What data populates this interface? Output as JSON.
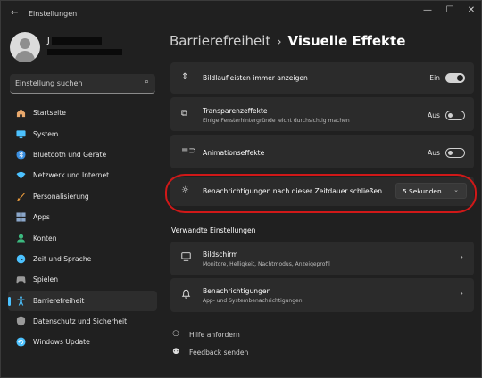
{
  "window": {
    "title": "Einstellungen"
  },
  "user": {
    "name_initial": "J"
  },
  "search": {
    "placeholder": "Einstellung suchen"
  },
  "sidebar": {
    "items": [
      {
        "label": "Startseite",
        "icon": "home-icon",
        "color": "#e8a86c"
      },
      {
        "label": "System",
        "icon": "monitor-icon",
        "color": "#4cc2ff"
      },
      {
        "label": "Bluetooth und Geräte",
        "icon": "bluetooth-icon",
        "color": "#3b8fe0"
      },
      {
        "label": "Netzwerk und Internet",
        "icon": "wifi-icon",
        "color": "#4cc2ff"
      },
      {
        "label": "Personalisierung",
        "icon": "brush-icon",
        "color": "#e89a3c"
      },
      {
        "label": "Apps",
        "icon": "apps-icon",
        "color": "#8aa6c9"
      },
      {
        "label": "Konten",
        "icon": "person-icon",
        "color": "#3cba80"
      },
      {
        "label": "Zeit und Sprache",
        "icon": "globe-clock-icon",
        "color": "#4cc2ff"
      },
      {
        "label": "Spielen",
        "icon": "gamepad-icon",
        "color": "#9a9a9a"
      },
      {
        "label": "Barrierefreiheit",
        "icon": "accessibility-icon",
        "color": "#4cc2ff"
      },
      {
        "label": "Datenschutz und Sicherheit",
        "icon": "shield-icon",
        "color": "#9a9a9a"
      },
      {
        "label": "Windows Update",
        "icon": "update-icon",
        "color": "#4cc2ff"
      }
    ]
  },
  "breadcrumb": {
    "parent": "Barrierefreiheit",
    "separator": "›",
    "current": "Visuelle Effekte"
  },
  "settings": {
    "scrollbars": {
      "title": "Bildlaufleisten immer anzeigen",
      "state": "Ein"
    },
    "transparency": {
      "title": "Transparenzeffekte",
      "subtitle": "Einige Fensterhintergründe leicht durchsichtig machen",
      "state": "Aus"
    },
    "animation": {
      "title": "Animationseffekte",
      "state": "Aus"
    },
    "notifications": {
      "title": "Benachrichtigungen nach dieser Zeitdauer schließen",
      "value": "5 Sekunden"
    }
  },
  "related": {
    "title": "Verwandte Einstellungen",
    "display": {
      "title": "Bildschirm",
      "subtitle": "Monitore, Helligkeit, Nachtmodus, Anzeigeprofil"
    },
    "notifications": {
      "title": "Benachrichtigungen",
      "subtitle": "App- und Systembenachrichtigungen"
    }
  },
  "links": {
    "help": "Hilfe anfordern",
    "feedback": "Feedback senden"
  },
  "colors": {
    "accent": "#4cc2ff",
    "highlight": "#d01818"
  }
}
